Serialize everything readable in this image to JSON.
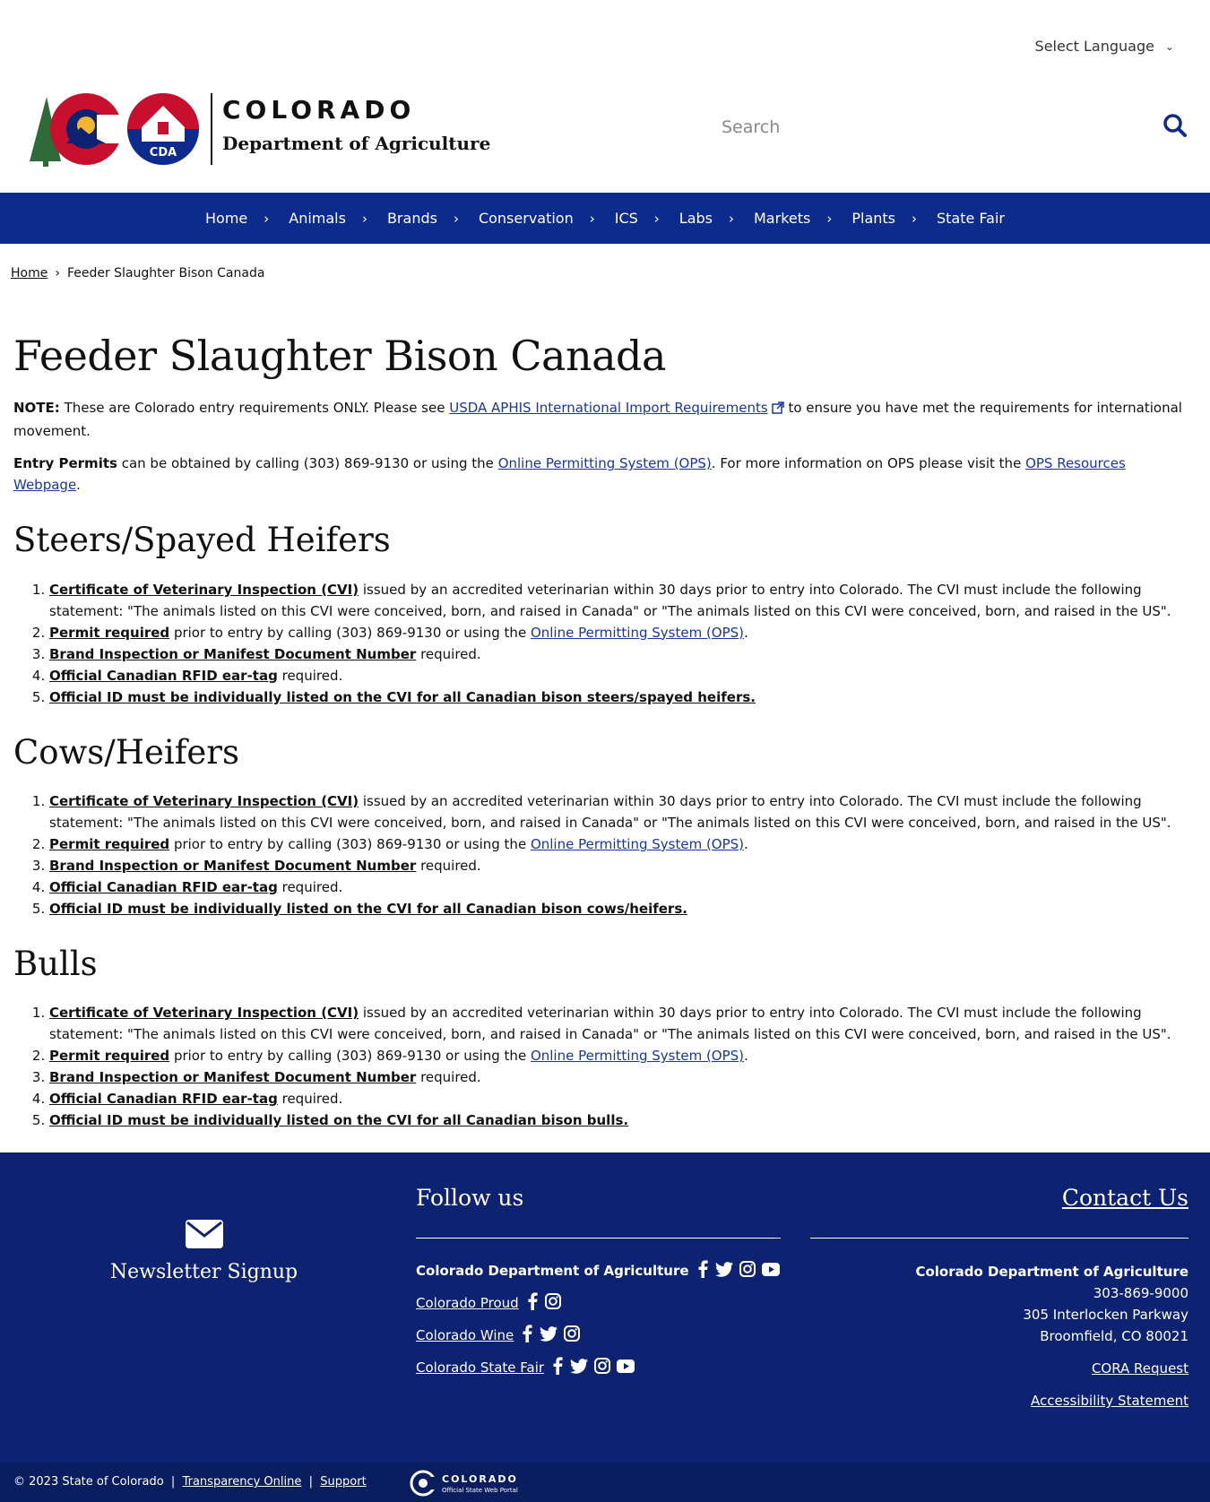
{
  "header": {
    "language_label": "Select Language",
    "logo_text_1": "COLORADO",
    "logo_text_2": "Department of Agriculture",
    "logo_badge": "CDA",
    "search_placeholder": "Search"
  },
  "nav": {
    "items": [
      "Home",
      "Animals",
      "Brands",
      "Conservation",
      "ICS",
      "Labs",
      "Markets",
      "Plants",
      "State Fair"
    ]
  },
  "breadcrumb": {
    "home": "Home",
    "current": "Feeder Slaughter Bison Canada"
  },
  "main": {
    "title": "Feeder Slaughter Bison Canada",
    "note_label": "NOTE:",
    "note_text_1": " These are Colorado entry requirements ONLY.  Please see ",
    "note_link": "USDA APHIS International Import Requirements",
    "note_text_2": " to ensure you have met the requirements for international movement.",
    "permits_label": "Entry Permits",
    "permits_text_1": " can be obtained by calling (303) 869-9130 or using the ",
    "permits_link_1": "Online Permitting System (OPS)",
    "permits_text_2": ". For more information on OPS please visit the ",
    "permits_link_2": "OPS Resources Webpage",
    "permits_text_3": ".",
    "sections": [
      {
        "heading": "Steers/Spayed Heifers",
        "last_item": "Official ID must be individually listed on the CVI for all Canadian bison steers/spayed heifers."
      },
      {
        "heading": "Cows/Heifers",
        "last_item": "Official ID must be individually listed on the CVI for all Canadian bison cows/heifers."
      },
      {
        "heading": "Bulls",
        "last_item": "Official ID must be individually listed on the CVI for all Canadian bison bulls."
      }
    ],
    "item1_link": "Certificate of Veterinary Inspection (CVI)",
    "item1_text": " issued by an accredited veterinarian within 30 days prior to entry into Colorado. The CVI must include the following statement: \"The animals listed on this CVI were conceived, born, and raised in Canada\" or \"The animals listed on this CVI were conceived, born, and raised in the US\".",
    "item2_link": "Permit required",
    "item2_text": " prior to entry by calling (303) 869-9130 or using the ",
    "item2_link_2": "Online Permitting System (OPS)",
    "item2_text_2": ".",
    "item3_link": "Brand Inspection or Manifest Document Number",
    "item3_text": " required.",
    "item4_link": "Official Canadian RFID ear-tag",
    "item4_text": " required."
  },
  "footer": {
    "newsletter": "Newsletter Signup",
    "follow_title": "Follow us",
    "follow_rows": [
      {
        "label": "Colorado Department of Agriculture"
      },
      {
        "label": "Colorado Proud"
      },
      {
        "label": "Colorado Wine"
      },
      {
        "label": "Colorado State Fair"
      }
    ],
    "contact_title": "Contact Us",
    "contact_name": "Colorado Department of Agriculture",
    "contact_phone": "303-869-9000",
    "contact_address_1": "305 Interlocken Parkway",
    "contact_address_2": "Broomfield, CO 80021",
    "cora": "CORA Request",
    "accessibility": "Accessibility Statement",
    "copyright": "© 2023 State of Colorado",
    "transparency": "Transparency Online",
    "support": "Support",
    "portal_text_1": "COLORADO",
    "portal_text_2": "Official State Web Portal"
  },
  "colors": {
    "nav_bg": "#0d2b8c",
    "footer_bg": "#0d2270",
    "link": "#1a35a3"
  }
}
